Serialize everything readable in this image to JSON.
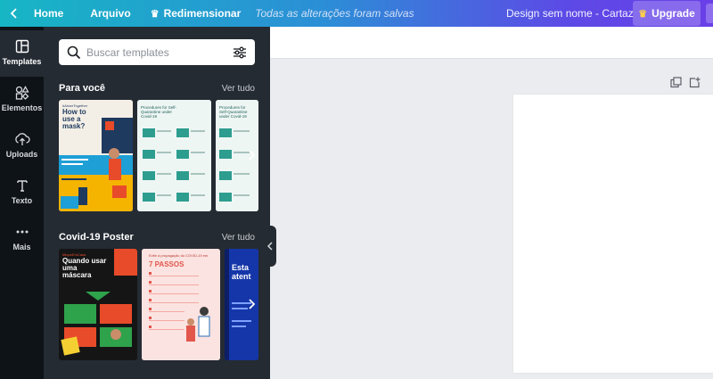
{
  "topbar": {
    "home": "Home",
    "file": "Arquivo",
    "resize": "Redimensionar",
    "saved_status": "Todas as alterações foram salvas",
    "doc_name": "Design sem nome - Cartaz",
    "upgrade": "Upgrade"
  },
  "rail": {
    "items": [
      {
        "label": "Templates",
        "icon": "templates-icon"
      },
      {
        "label": "Elementos",
        "icon": "elements-icon"
      },
      {
        "label": "Uploads",
        "icon": "upload-icon"
      },
      {
        "label": "Texto",
        "icon": "text-icon"
      },
      {
        "label": "Mais",
        "icon": "more-icon"
      }
    ]
  },
  "panel": {
    "search_placeholder": "Buscar templates",
    "sections": [
      {
        "title": "Para você",
        "link": "Ver tudo",
        "thumbs": [
          {
            "title": "How to use a mask?",
            "kicker": "#AloneTogether"
          },
          {
            "title": "Procedures for Self-Quarantine under Covid-19"
          },
          {
            "title": "Procedures for Self-Quarantine under Covid-19"
          }
        ]
      },
      {
        "title": "Covid-19 Poster",
        "link": "Ver tudo",
        "thumbs": [
          {
            "title": "Quando usar uma máscara",
            "kicker": "#fiqueEmCasa"
          },
          {
            "title": "7 PASSOS",
            "kicker": "Evite a propagação do COVID-19 em"
          },
          {
            "title": "Esta atent"
          }
        ]
      }
    ]
  },
  "colors": {
    "accent_teal": "#17b6c5",
    "accent_purple": "#6a3fe8",
    "sidebar": "#0e1318",
    "panel": "#252b33",
    "workspace": "#ebecf0"
  }
}
